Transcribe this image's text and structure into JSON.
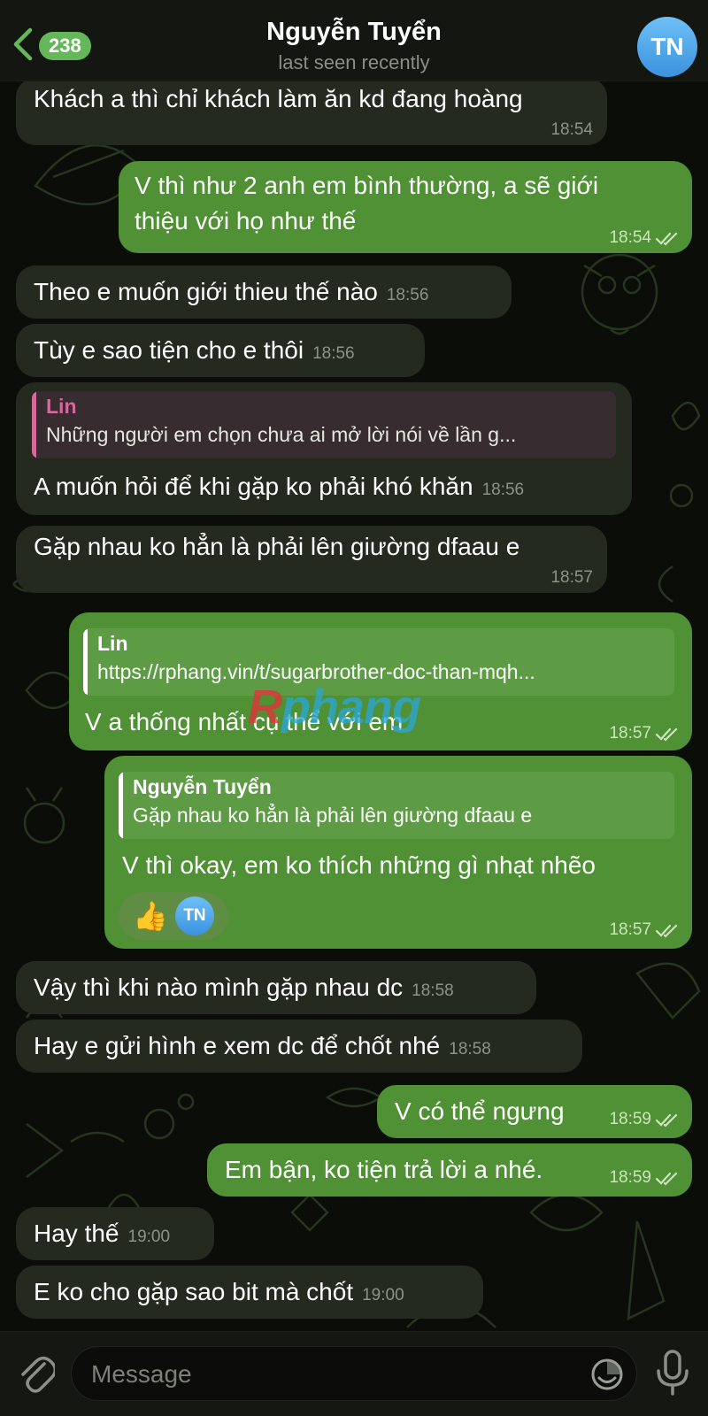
{
  "header": {
    "back_count": "238",
    "title": "Nguyễn Tuyển",
    "subtitle": "last seen recently",
    "avatar_initials": "TN"
  },
  "messages": [
    {
      "dir": "in",
      "text": "Khách a thì chỉ khách làm ăn kd đang hoàng",
      "time": "18:54"
    },
    {
      "dir": "out",
      "lines": [
        "V thì như 2 anh em bình thường, a sẽ giới",
        "thiệu với họ như thế"
      ],
      "time": "18:54"
    },
    {
      "dir": "in",
      "text": "Theo e muốn giới thieu thế nào",
      "time": "18:56"
    },
    {
      "dir": "in",
      "text": "Tùy e sao tiện cho e thôi",
      "time": "18:56"
    },
    {
      "dir": "in",
      "quote_name": "Lin",
      "quote_text": "Những người em chọn chưa ai mở lời nói về lần g...",
      "text": "A muốn hỏi để khi gặp ko phải khó khăn",
      "time": "18:56"
    },
    {
      "dir": "in",
      "text": "Gặp nhau ko hẳn là phải lên giường dfaau e",
      "time": "18:57"
    },
    {
      "dir": "out",
      "quote_name": "Lin",
      "quote_text": "https://rphang.vin/t/sugarbrother-doc-than-mqh...",
      "text": "V a thống nhất cụ thể với em",
      "time": "18:57"
    },
    {
      "dir": "out",
      "quote_name": "Nguyễn Tuyển",
      "quote_text": "Gặp nhau ko hẳn là phải lên giường dfaau e",
      "text": "V thì okay, em ko thích những gì nhạt nhẽo",
      "reaction_emoji": "👍",
      "reaction_avatar": "TN",
      "time": "18:57"
    },
    {
      "dir": "in",
      "text": "Vậy thì khi nào mình gặp nhau dc",
      "time": "18:58"
    },
    {
      "dir": "in",
      "text": "Hay e gửi hình e xem dc để chốt nhé",
      "time": "18:58"
    },
    {
      "dir": "out",
      "text": "V có thể ngưng",
      "time": "18:59"
    },
    {
      "dir": "out",
      "text": "Em bận, ko tiện trả lời a nhé.",
      "time": "18:59"
    },
    {
      "dir": "in",
      "text": "Hay thế",
      "time": "19:00"
    },
    {
      "dir": "in",
      "text": "E ko cho gặp sao bit mà chốt",
      "time": "19:00"
    }
  ],
  "watermark": {
    "part1": "R",
    "part2": "phang"
  },
  "composer": {
    "placeholder": "Message"
  },
  "colors": {
    "incoming_bubble": "#242a1f",
    "outgoing_bubble": "#4f9134",
    "accent_green": "#64b85a",
    "quote_in_accent": "#d36a9a",
    "avatar_blue": "#3b92de"
  },
  "icons": [
    "back-chevron-icon",
    "paperclip-icon",
    "sticker-icon",
    "microphone-icon",
    "double-check-icon"
  ]
}
